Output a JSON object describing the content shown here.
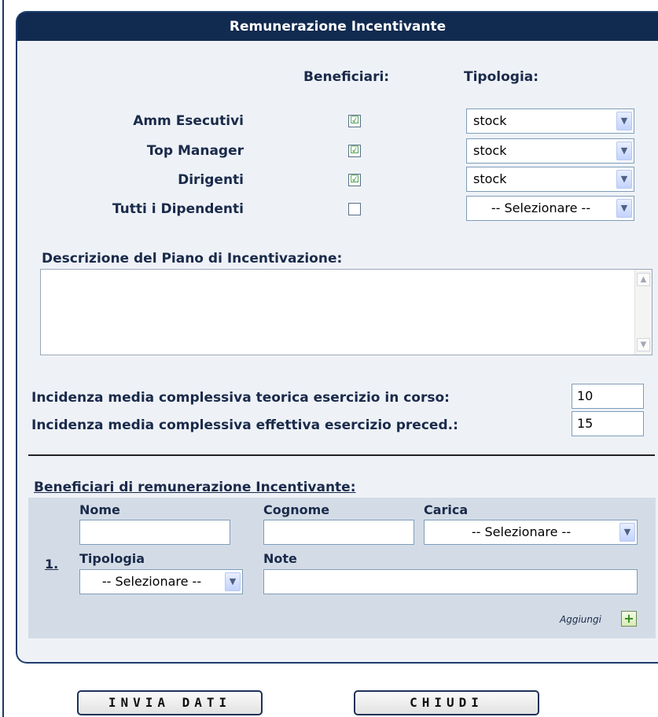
{
  "panel": {
    "title": "Remunerazione Incentivante"
  },
  "columns": {
    "beneficiari": "Beneficiari:",
    "tipologia": "Tipologia:"
  },
  "rows": [
    {
      "label": "Amm Esecutivi",
      "checked": true,
      "check_glyph": "☑",
      "tipologia": "stock"
    },
    {
      "label": "Top Manager",
      "checked": true,
      "check_glyph": "☑",
      "tipologia": "stock"
    },
    {
      "label": "Dirigenti",
      "checked": true,
      "check_glyph": "☑",
      "tipologia": "stock"
    },
    {
      "label": "Tutti i Dipendenti",
      "checked": false,
      "check_glyph": "",
      "tipologia": "-- Selezionare --"
    }
  ],
  "descrizione": {
    "label": "Descrizione del Piano di Incentivazione:",
    "value": ""
  },
  "incidenza": {
    "teorica_label": "Incidenza media complessiva teorica esercizio in corso:",
    "teorica_value": "10",
    "effettiva_label": "Incidenza media complessiva effettiva esercizio preced.:",
    "effettiva_value": "15"
  },
  "beneficiari_section": {
    "title": "Beneficiari di remunerazione Incentivante:",
    "row_index": "1.",
    "nome_label": "Nome",
    "nome_value": "",
    "cognome_label": "Cognome",
    "cognome_value": "",
    "carica_label": "Carica",
    "carica_value": "-- Selezionare --",
    "tipologia_label": "Tipologia",
    "tipologia_value": "-- Selezionare --",
    "note_label": "Note",
    "note_value": "",
    "aggiungi_label": "Aggiungi"
  },
  "buttons": {
    "invia": "INVIA DATI",
    "chiudi": "CHIUDI"
  },
  "icons": {
    "dropdown": "chevron-down-icon",
    "add": "plus-icon",
    "checkbox": "checkbox-icon"
  },
  "colors": {
    "header": "#112a50",
    "panel_bg": "#eef2f7",
    "benef_bg": "#d3dce6",
    "check": "#148014"
  }
}
